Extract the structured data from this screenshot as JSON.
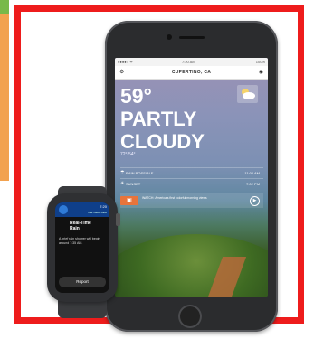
{
  "phone": {
    "status_left": "●●●●○ ᯤ",
    "status_time": "7:20 AM",
    "status_battery": "100%",
    "location": "CUPERTINO, CA",
    "temperature": "59°",
    "condition_line1": "PARTLY",
    "condition_line2": "CLOUDY",
    "hi_lo": "72°/54°",
    "rows": [
      {
        "icon": "rain-icon",
        "label": "RAIN POSSIBLE",
        "value": "11:00 AM"
      },
      {
        "icon": "sunset-icon",
        "label": "SUNSET",
        "value": "7:02 PM"
      }
    ],
    "alert_text": "WATCH: America's first colorful morning views"
  },
  "watch": {
    "time": "7:20",
    "app_name": "THE WEATHER",
    "title_line1": "Real-Time",
    "title_line2": "Rain",
    "body": "A brief rain shower will begin around 7:35 AM.",
    "report_label": "Report"
  },
  "colors": {
    "frame_border": "#ee1c1c",
    "watch_header": "#0f3f8a",
    "alert_badge": "#e8743b"
  }
}
